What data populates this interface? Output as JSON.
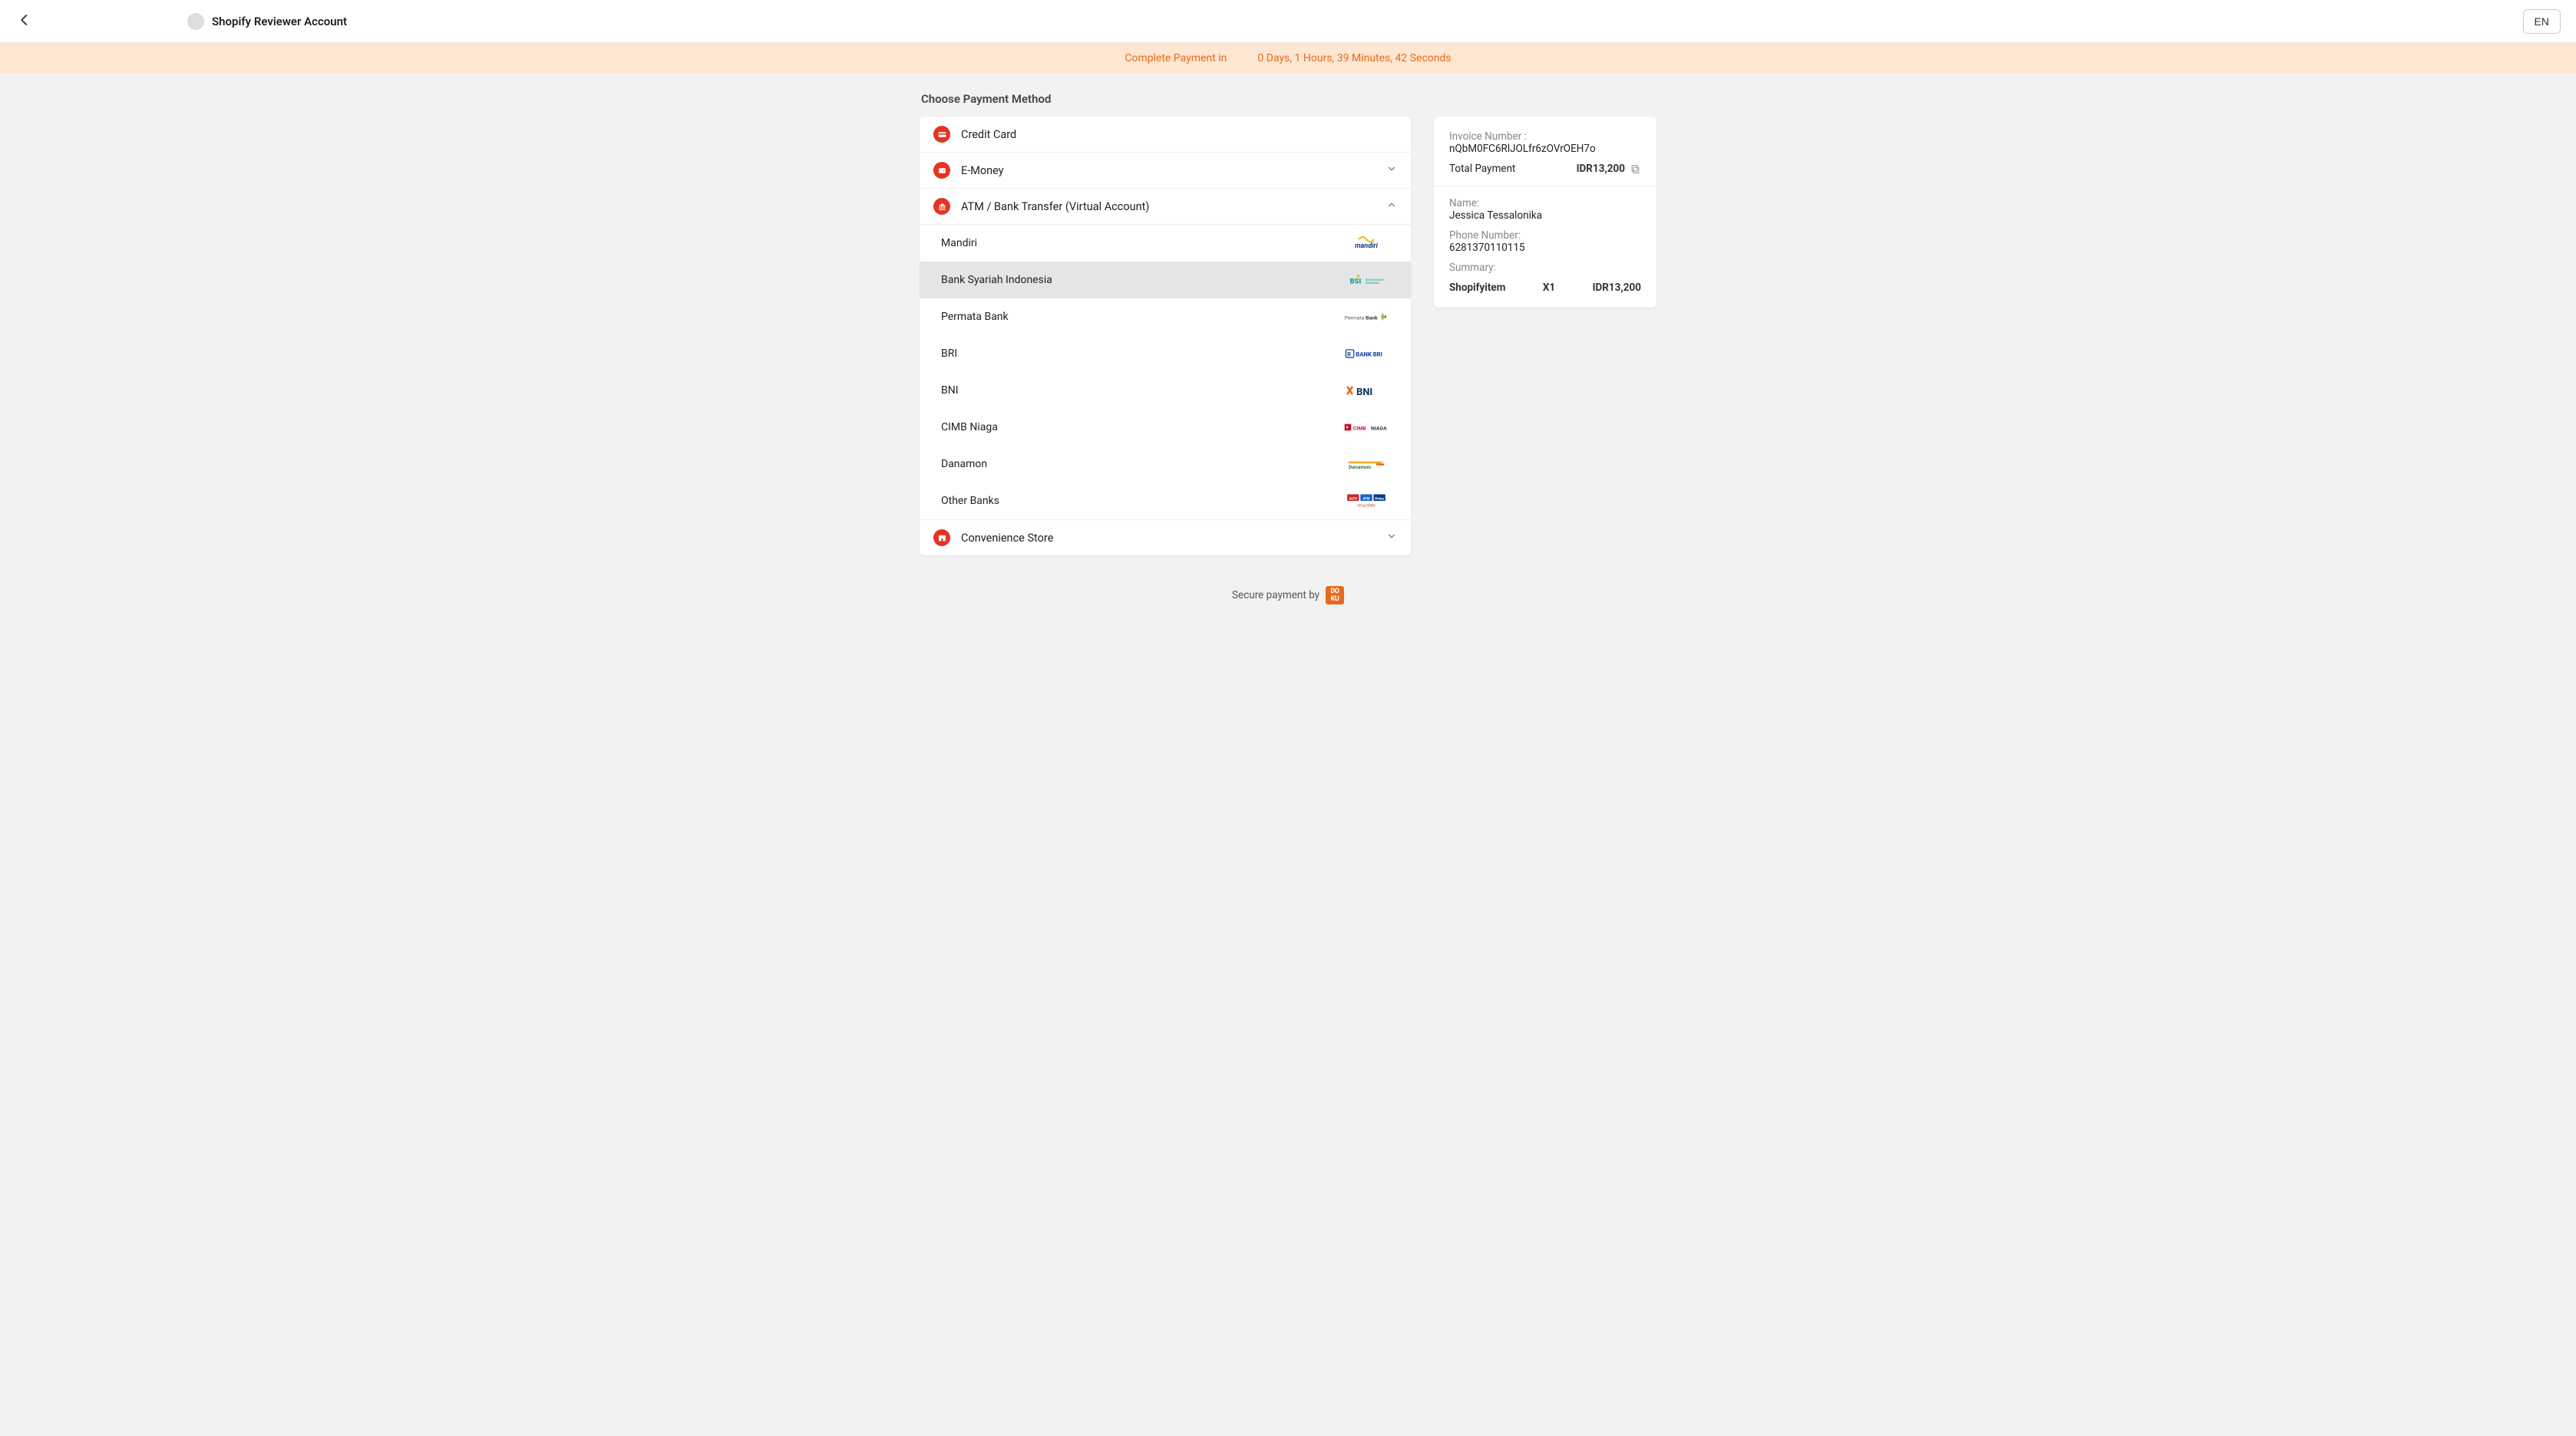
{
  "header": {
    "title": "Shopify Reviewer Account",
    "language": "EN"
  },
  "countdown": {
    "label": "Complete Payment in",
    "value": "0 Days, 1 Hours, 39 Minutes, 42 Seconds"
  },
  "heading": "Choose Payment Method",
  "methods": [
    {
      "id": "credit-card",
      "label": "Credit Card",
      "icon": "card",
      "expanded": false,
      "no_chevron": true
    },
    {
      "id": "e-money",
      "label": "E-Money",
      "icon": "wallet",
      "expanded": false
    },
    {
      "id": "va",
      "label": "ATM / Bank Transfer (Virtual Account)",
      "icon": "bank",
      "expanded": true
    },
    {
      "id": "cvs",
      "label": "Convenience Store",
      "icon": "store",
      "expanded": false
    }
  ],
  "banks": [
    {
      "name": "Mandiri",
      "logo": "mandiri"
    },
    {
      "name": "Bank Syariah Indonesia",
      "logo": "bsi",
      "hovered": true
    },
    {
      "name": "Permata Bank",
      "logo": "permata"
    },
    {
      "name": "BRI",
      "logo": "bri"
    },
    {
      "name": "BNI",
      "logo": "bni"
    },
    {
      "name": "CIMB Niaga",
      "logo": "cimb"
    },
    {
      "name": "Danamon",
      "logo": "danamon"
    },
    {
      "name": "Other Banks",
      "logo": "other"
    }
  ],
  "summary": {
    "invoice_label": "Invoice Number :",
    "invoice_number": "nQbM0FC6RlJOLfr6zOVrOEH7o",
    "total_label": "Total Payment",
    "total_value": "IDR13,200",
    "name_label": "Name:",
    "name_value": "Jessica Tessalonika",
    "phone_label": "Phone Number:",
    "phone_value": "6281370110115",
    "summary_label": "Summary:",
    "item_name": "Shopifyitem",
    "item_qty": "X1",
    "item_price": "IDR13,200"
  },
  "footer": {
    "text": "Secure payment by",
    "brand": "DOKU"
  }
}
